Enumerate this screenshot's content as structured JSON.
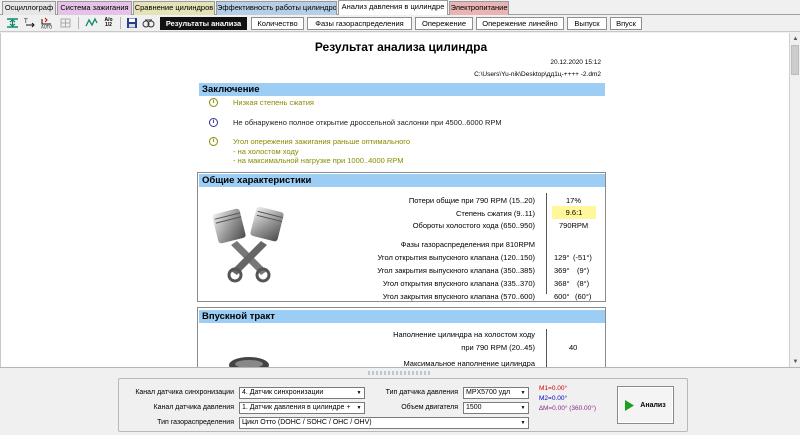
{
  "module_tabs": [
    {
      "label": "Осциллограф",
      "color": "#e6e6e6"
    },
    {
      "label": "Система зажигания",
      "color": "#e5c3e6"
    },
    {
      "label": "Сравнение цилиндров",
      "color": "#e4e2b6"
    },
    {
      "label": "Эффективность работы цилиндров",
      "color": "#b7cfe6"
    },
    {
      "label": "Анализ давления в цилиндре",
      "color": "#ffffff"
    },
    {
      "label": "Электропитание",
      "color": "#e8b4b4"
    }
  ],
  "toolbar": {
    "icons": [
      "sync-markers-icon",
      "scale-time-icon",
      "auto-scale-icon",
      "disabled-grid-icon",
      "waveform-icon",
      "ratio-icon",
      "save-icon",
      "compare-icon"
    ],
    "ratio_label": "A/o 1/2"
  },
  "report_tabs": [
    "Результаты анализа",
    "Количество",
    "Фазы газораспределения",
    "Опережение",
    "Опережение линейно",
    "Выпуск",
    "Впуск"
  ],
  "report": {
    "title": "Результат анализа цилиндра",
    "date": "20.12.2020 15:12",
    "path": "C:\\Users\\Yu-nik\\Desktop\\дд1ц-++++ -2.dm2"
  },
  "conclusion": {
    "heading": "Заключение",
    "items": [
      {
        "icon": "warning-icon",
        "color": "#8a8a00",
        "text": "Низкая степень сжатия"
      },
      {
        "icon": "info-icon",
        "color": "#333399",
        "text": "Не обнаружено полное открытие дроссельной заслонки при 4500..6000 RPM"
      },
      {
        "icon": "warning-icon",
        "color": "#8a8a00",
        "lines": [
          "Угол опережения зажигания раньше оптимального",
          "- на холостом ходу",
          "- на максимальной нагрузке при 1000..4000 RPM"
        ]
      }
    ]
  },
  "general": {
    "heading": "Общие характеристики",
    "rows": [
      {
        "label": "Потери общие при 790 RPM (15..20)",
        "value": "17%"
      },
      {
        "label": "Степень сжатия (9..11)",
        "value": "9.6:1",
        "highlight": "#fff799"
      },
      {
        "label": "Обороты холостого хода (650..950)",
        "value": "790RPM"
      }
    ],
    "phases_title": "Фазы газораспределения при 810RPM",
    "phases": [
      {
        "label": "Угол открытия выпускного клапана (120..150)",
        "value": "129°",
        "delta": "(-51°)"
      },
      {
        "label": "Угол закрытия выпускного клапана (350..385)",
        "value": "369°",
        "delta": "(9°)"
      },
      {
        "label": "Угол открытия впускного клапана (335..370)",
        "value": "368°",
        "delta": "(8°)"
      },
      {
        "label": "Угол закрытия впускного клапана (570..600)",
        "value": "600°",
        "delta": "(60°)"
      }
    ]
  },
  "intake": {
    "heading": "Впускной тракт",
    "row1_line1": "Наполнение цилиндра на холостом ходу",
    "row1_line2": "при 790 RPM (20..45)",
    "row1_value": "40",
    "row2": "Максимальное наполнение цилиндра"
  },
  "controls": {
    "sync_label": "Канал датчика синхронизации",
    "sync_value": "4.  Датчик синхронизации",
    "pressure_label": "Канал датчика давления",
    "pressure_value": "1.  Датчик давления в цилиндре +",
    "timing_label": "Тип газораспределения",
    "timing_value": "Цикл Отто (DOHC / SOHC / OHC / OHV)",
    "sensor_type_label": "Тип датчика давления",
    "sensor_type_value": "MPX5700 удл",
    "engine_volume_label": "Объем двигателя",
    "engine_volume_value": "1500",
    "m1": "M1=0.00°",
    "m2": "M2=0.00°",
    "dm": "∆M=0.00° (360.00°)",
    "m1_color": "#d00000",
    "m2_color": "#0000c0",
    "dm_color": "#8a2a8a",
    "analyze_label": "Анализ"
  }
}
